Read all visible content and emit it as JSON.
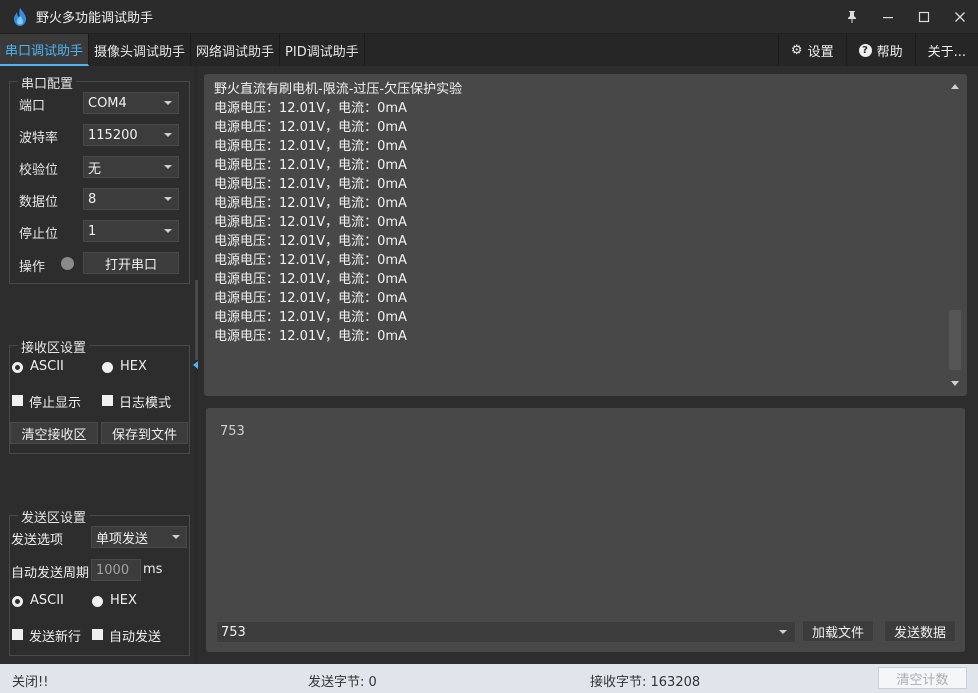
{
  "window": {
    "title": "野火多功能调试助手",
    "controls": [
      "pin-icon",
      "minimize-icon",
      "maximize-icon",
      "close-icon"
    ]
  },
  "tabs": [
    {
      "label": "串口调试助手",
      "active": true
    },
    {
      "label": "摄像头调试助手",
      "active": false
    },
    {
      "label": "网络调试助手",
      "active": false
    },
    {
      "label": "PID调试助手",
      "active": false
    }
  ],
  "menu": {
    "settings": "设置",
    "help": "帮助",
    "about": "关于..."
  },
  "serial_config": {
    "title": "串口配置",
    "port_label": "端口",
    "port_value": "COM4",
    "baud_label": "波特率",
    "baud_value": "115200",
    "parity_label": "校验位",
    "parity_value": "无",
    "databits_label": "数据位",
    "databits_value": "8",
    "stopbits_label": "停止位",
    "stopbits_value": "1",
    "operation_label": "操作",
    "open_button": "打开串口"
  },
  "recv_settings": {
    "title": "接收区设置",
    "ascii": "ASCII",
    "hex": "HEX",
    "ascii_selected": true,
    "stop_display": "停止显示",
    "log_mode": "日志模式",
    "clear_button": "清空接收区",
    "save_button": "保存到文件"
  },
  "send_settings": {
    "title": "发送区设置",
    "option_label": "发送选项",
    "option_value": "单项发送",
    "period_label": "自动发送周期",
    "period_value": "1000",
    "period_unit": "ms",
    "ascii": "ASCII",
    "hex": "HEX",
    "ascii_selected": true,
    "newline": "发送新行",
    "auto_send": "自动发送"
  },
  "receive": {
    "lines": [
      "野火直流有刷电机-限流-过压-欠压保护实验",
      "电源电压：12.01V，电流：0mA",
      "电源电压：12.01V，电流：0mA",
      "电源电压：12.01V，电流：0mA",
      "电源电压：12.01V，电流：0mA",
      "电源电压：12.01V，电流：0mA",
      "电源电压：12.01V，电流：0mA",
      "电源电压：12.01V，电流：0mA",
      "电源电压：12.01V，电流：0mA",
      "电源电压：12.01V，电流：0mA",
      "电源电压：12.01V，电流：0mA",
      "电源电压：12.01V，电流：0mA",
      "电源电压：12.01V，电流：0mA",
      "电源电压：12.01V，电流：0mA"
    ]
  },
  "send": {
    "text": "753",
    "history_value": "753",
    "load_file_button": "加载文件",
    "send_button": "发送数据"
  },
  "status": {
    "state": "关闭!!",
    "sent_bytes": "发送字节: 0",
    "received_bytes": "接收字节: 163208",
    "clear_count_button": "清空计数"
  }
}
